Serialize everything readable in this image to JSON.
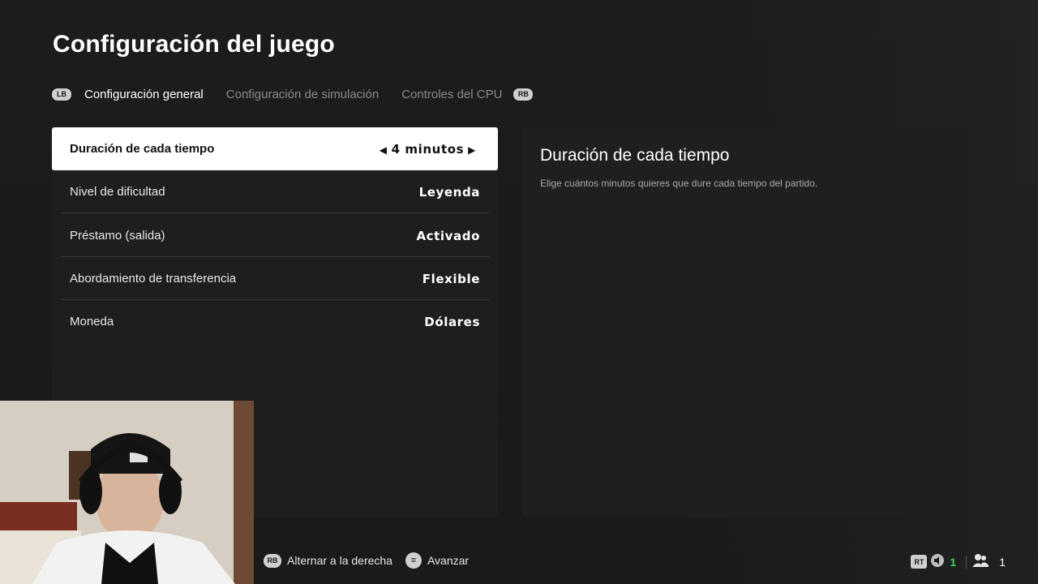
{
  "header": {
    "title": "Configuración del juego"
  },
  "tabs": {
    "left_button": "LB",
    "right_button": "RB",
    "items": [
      {
        "label": "Configuración general"
      },
      {
        "label": "Configuración de simulación"
      },
      {
        "label": "Controles del CPU"
      }
    ]
  },
  "settings": [
    {
      "label": "Duración de cada tiempo",
      "value": "4 minutos"
    },
    {
      "label": "Nivel de dificultad",
      "value": "Leyenda"
    },
    {
      "label": "Préstamo (salida)",
      "value": "Activado"
    },
    {
      "label": "Abordamiento de transferencia",
      "value": "Flexible"
    },
    {
      "label": "Moneda",
      "value": "Dólares"
    }
  ],
  "detail": {
    "title": "Duración de cada tiempo",
    "description": "Elige cuántos minutos quieres que dure cada tiempo del partido."
  },
  "footer": {
    "hint1_button": "RB",
    "hint1_label": "Alternar a la derecha",
    "hint2_label": "Avanzar",
    "rt_button": "RT",
    "voice_count": "1",
    "players_count": "1"
  },
  "colors": {
    "accent_green": "#3ad15a",
    "selected_row_bg": "#ffffff"
  }
}
